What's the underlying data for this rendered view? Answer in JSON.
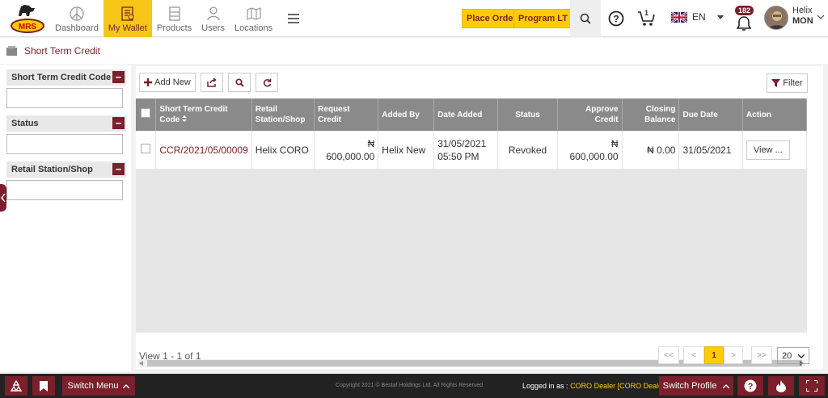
{
  "header": {
    "logo_text": "MRS",
    "nav": [
      {
        "label": "Dashboard",
        "icon": "dashboard-icon"
      },
      {
        "label": "My Wallet",
        "icon": "wallet-icon",
        "active": true
      },
      {
        "label": "Products",
        "icon": "products-icon"
      },
      {
        "label": "Users",
        "icon": "users-icon"
      },
      {
        "label": "Locations",
        "icon": "locations-icon"
      }
    ],
    "place_order": "Place Order",
    "program_lt": "Program LT",
    "cart_count": "1",
    "language": "EN",
    "notification_count": "182",
    "user_name": "Helix",
    "user_role": "MON"
  },
  "breadcrumb": {
    "title": "Short Term Credit"
  },
  "filters": {
    "code_label": "Short Term Credit Code",
    "status_label": "Status",
    "station_label": "Retail Station/Shop",
    "code_value": "",
    "status_value": "",
    "station_value": ""
  },
  "toolbar": {
    "add_new": "Add New",
    "filter": "Filter"
  },
  "table": {
    "headers": {
      "code": "Short Term Credit Code",
      "station": "Retail Station/Shop",
      "request": "Request Credit",
      "added_by": "Added By",
      "date_added": "Date Added",
      "status": "Status",
      "approve": "Approve Credit",
      "closing": "Closing Balance",
      "due": "Due Date",
      "action": "Action"
    },
    "rows": [
      {
        "code": "CCR/2021/05/00009",
        "station": "Helix CORO",
        "request_currency": "₦",
        "request_amount": "600,000.00",
        "added_by": "Helix New",
        "date": "31/05/2021",
        "time": "05:50 PM",
        "status": "Revoked",
        "approve_currency": "₦",
        "approve_amount": "600,000.00",
        "closing": "₦ 0.00",
        "due": "31/05/2021",
        "action": "View ..."
      }
    ]
  },
  "pagination": {
    "summary": "View 1 - 1 of 1",
    "first": "<<",
    "prev": "<",
    "current": "1",
    "next": ">",
    "last": ">>",
    "per_page": "20"
  },
  "footer": {
    "switch_menu": "Switch Menu",
    "copyright": "Copyright 2021 © Bestaf Holdings Ltd. All Rights Reserved",
    "logged_in_prefix": "Logged in as :",
    "logged_in_value": "CORO Dealer [CORO Dealer]",
    "switch_profile": "Switch Profile"
  },
  "colors": {
    "brand": "#7a1f2b",
    "accent": "#ffcc00",
    "header_grid": "#8a8a8a"
  }
}
